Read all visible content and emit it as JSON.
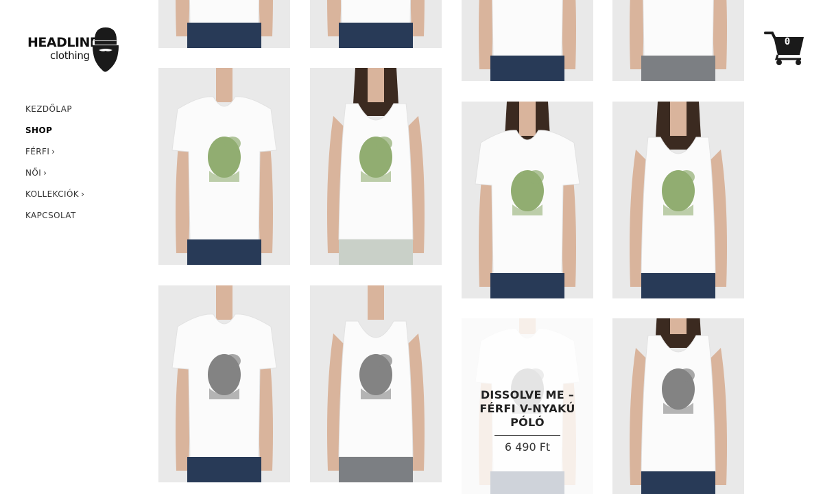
{
  "brand": {
    "name": "HEADLINE",
    "sub": "clothing"
  },
  "nav": {
    "items": [
      {
        "label": "KEZDŐLAP",
        "chevron": ""
      },
      {
        "label": "SHOP",
        "chevron": ""
      },
      {
        "label": "FÉRFI",
        "chevron": "›"
      },
      {
        "label": "NŐI",
        "chevron": "›"
      },
      {
        "label": "KOLLEKCIÓK",
        "chevron": "›"
      },
      {
        "label": "KAPCSOLAT",
        "chevron": ""
      }
    ]
  },
  "cart": {
    "count": "0",
    "icon": "shopping-cart-icon"
  },
  "colors": {
    "background": "#ffffff",
    "photo_bg": "#e9e9e9",
    "skin": "#d9b49c",
    "jeans": "#283a57",
    "shorts": "#c9d0c8",
    "grey_pants": "#7c7f83",
    "shirt": "#fbfbfb",
    "hair": "#3b2a20",
    "print_green": "#7fa05a",
    "print_grey": "#6f6f6f"
  },
  "products": [
    {
      "style": "women-tee",
      "print": "gray",
      "bottom": "jeans"
    },
    {
      "style": "women-tee",
      "print": "gray",
      "bottom": "jeans"
    },
    {
      "style": "men-tee",
      "print": "gray",
      "bottom": "jeans"
    },
    {
      "style": "men-tee",
      "print": "gray",
      "bottom": "grey-pants"
    },
    {
      "style": "men-vneck",
      "print": "green",
      "bottom": "jeans"
    },
    {
      "style": "women-tank",
      "print": "green",
      "bottom": "shorts"
    },
    {
      "style": "women-scoop",
      "print": "green",
      "bottom": "jeans"
    },
    {
      "style": "women-tank",
      "print": "green",
      "bottom": "jeans"
    },
    {
      "style": "men-tee",
      "print": "gray",
      "bottom": "jeans"
    },
    {
      "style": "men-tank",
      "print": "gray",
      "bottom": "grey-pants"
    },
    {
      "style": "men-vneck",
      "print": "gray",
      "bottom": "jeans",
      "hover_title": "DISSOLVE ME – FÉRFI V-NYAKÚ PÓLÓ",
      "hover_price": "6 490 Ft"
    },
    {
      "style": "women-tank",
      "print": "gray",
      "bottom": "jeans"
    }
  ]
}
